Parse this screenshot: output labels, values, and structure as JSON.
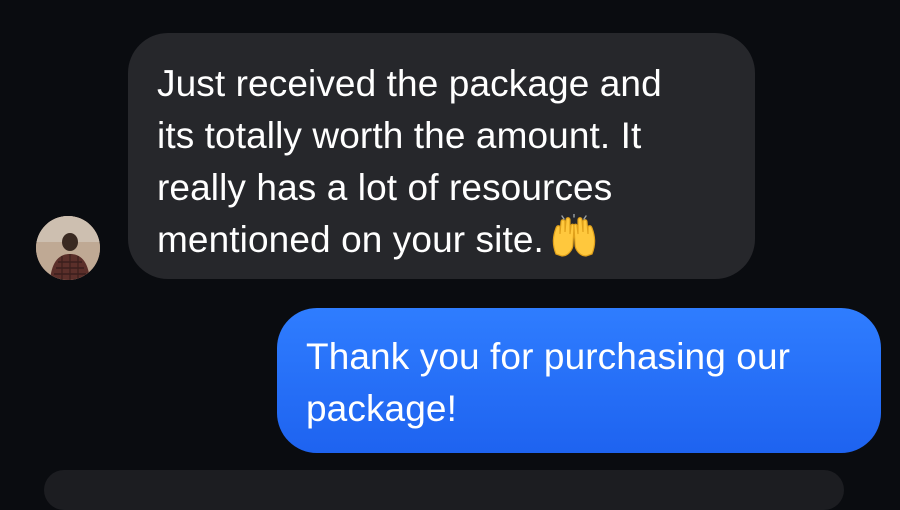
{
  "conversation": {
    "contact_avatar_icon": "user-photo-avatar",
    "incoming_message": {
      "lines": [
        "Just received the package and",
        "its totally worth the amount. It",
        "really has a lot of resources",
        "mentioned on your site."
      ],
      "emoji": "raising-hands-emoji",
      "bubble_color": "#26272b"
    },
    "outgoing_message": {
      "lines": [
        "Thank you for purchasing our",
        "package!"
      ],
      "bubble_color": "#1e63f0"
    },
    "background_color": "#0a0c10"
  }
}
